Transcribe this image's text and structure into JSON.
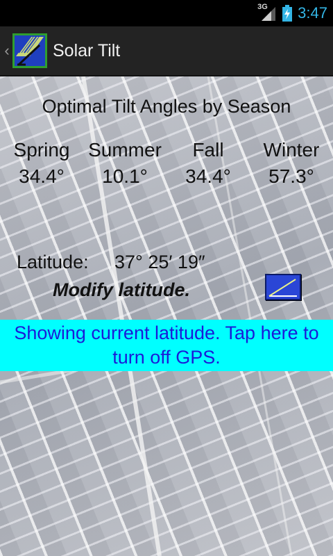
{
  "status_bar": {
    "network": "3G",
    "time": "3:47",
    "time_color": "#33b5e5"
  },
  "action_bar": {
    "title": "Solar Tilt",
    "icon": "solar-panel-app-icon",
    "up_icon": "chevron-left-icon"
  },
  "heading": "Optimal Tilt Angles by Season",
  "seasons": [
    {
      "name": "Spring",
      "angle": "34.4°"
    },
    {
      "name": "Summer",
      "angle": "10.1°"
    },
    {
      "name": "Fall",
      "angle": "34.4°"
    },
    {
      "name": "Winter",
      "angle": "57.3°"
    }
  ],
  "latitude": {
    "label": "Latitude:",
    "value": "37°  25′  19″",
    "modify_label": "Modify latitude.",
    "button_icon": "latitude-angle-icon"
  },
  "gps_banner": {
    "text": "Showing current latitude. Tap here to turn off GPS.",
    "background": "#00ffff",
    "text_color": "#1b1bd8"
  }
}
